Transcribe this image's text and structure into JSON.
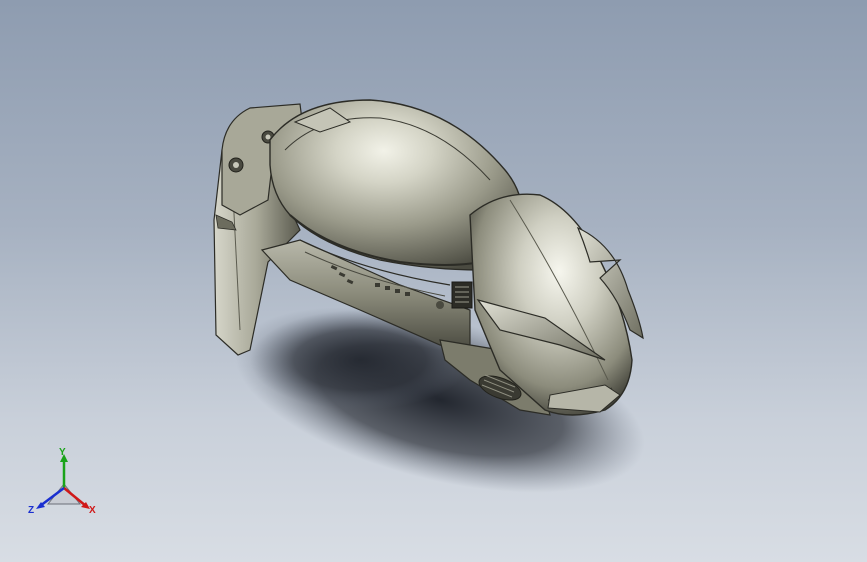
{
  "viewport": {
    "background_top": "#8e9cb0",
    "background_bottom": "#d8dde4",
    "model": {
      "body_color": "#9c9c8c",
      "highlight_color": "#efefe4",
      "shadow_color": "#3c3c34"
    }
  },
  "triad": {
    "x_label": "X",
    "y_label": "Y",
    "z_label": "Z",
    "x_color": "#d01818",
    "y_color": "#1aa31a",
    "z_color": "#1a2fd0"
  }
}
